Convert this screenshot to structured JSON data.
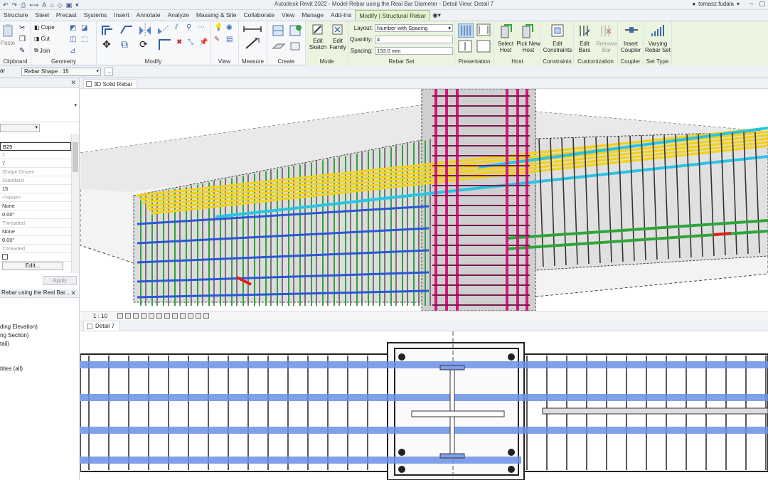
{
  "window": {
    "title": "Autodesk Revit 2022 - Model Rebar using the Real Bar Diameter - Detail View: Detail 7",
    "user": "tomasz.fudala"
  },
  "tabs": [
    {
      "label": "Structure"
    },
    {
      "label": "Steel"
    },
    {
      "label": "Precast"
    },
    {
      "label": "Systems"
    },
    {
      "label": "Insert"
    },
    {
      "label": "Annotate"
    },
    {
      "label": "Analyze"
    },
    {
      "label": "Massing & Site"
    },
    {
      "label": "Collaborate"
    },
    {
      "label": "View"
    },
    {
      "label": "Manage"
    },
    {
      "label": "Add-Ins"
    },
    {
      "label": "Modify | Structural Rebar"
    }
  ],
  "ribbon": {
    "paste": "Paste",
    "cope": "Cope",
    "cut": "Cut",
    "join": "Join",
    "panels": {
      "clipboard": "Clipboard",
      "geometry": "Geometry",
      "modify": "Modify",
      "view": "View",
      "measure": "Measure",
      "create": "Create",
      "mode": "Mode",
      "rebar_set": "Rebar Set",
      "presentation": "Presentation",
      "host": "Host",
      "constraints": "Constraints",
      "customization": "Customization",
      "coupler": "Coupler",
      "set_type": "Set Type"
    },
    "mode_buttons": {
      "edit_sketch": [
        "Edit",
        "Sketch"
      ],
      "edit_family": [
        "Edit",
        "Family"
      ]
    },
    "rebar_set": {
      "layout_label": "Layout:",
      "layout_value": "Number with Spacing",
      "quantity_label": "Quantity:",
      "quantity_value": "4",
      "spacing_label": "Spacing:",
      "spacing_value": "133.0 mm"
    },
    "host_buttons": {
      "select_host": [
        "Select",
        "Host"
      ],
      "pick_new_host": [
        "Pick New",
        "Host"
      ]
    },
    "constraints_buttons": {
      "edit_constraints": [
        "Edit",
        "Constraints"
      ]
    },
    "custom_buttons": {
      "edit_bars": [
        "Edit",
        "Bars"
      ],
      "remove_bar": [
        "Remove",
        "Bar"
      ]
    },
    "coupler_buttons": {
      "insert_coupler": [
        "Insert",
        "Coupler"
      ]
    },
    "settype_buttons": {
      "varying_rebar_set": [
        "Varying",
        "Rebar Set"
      ]
    }
  },
  "options_bar": {
    "left_label": "ar",
    "rebar_shape": "Rebar Shape : 15",
    "dots": "..."
  },
  "properties": {
    "rows": [
      "B25",
      "1",
      "7",
      "Shape Driven",
      "Standard",
      "15",
      "<None>",
      "None",
      "0.00°",
      "Threaded",
      "None",
      "0.00°",
      "Threaded",
      ""
    ],
    "edit_label": "Edit...",
    "apply_label": "Apply"
  },
  "browser": {
    "header": "Rebar using the Real Bar...",
    "items": [
      "ding Elevation)",
      "ng Section)",
      "tail)",
      "tities (all)"
    ]
  },
  "views": {
    "view3d_tab": "3D Solid Rebar",
    "view3d_scale": "1 : 10",
    "detail_tab": "Detail 7"
  },
  "colors": {
    "accent": "#9bc27a",
    "rebar_yellow": "#f2d21b",
    "rebar_magenta": "#d2177d",
    "rebar_blue": "#2b55d9",
    "rebar_cyan": "#29c4e6",
    "rebar_green": "#2fa43a"
  }
}
